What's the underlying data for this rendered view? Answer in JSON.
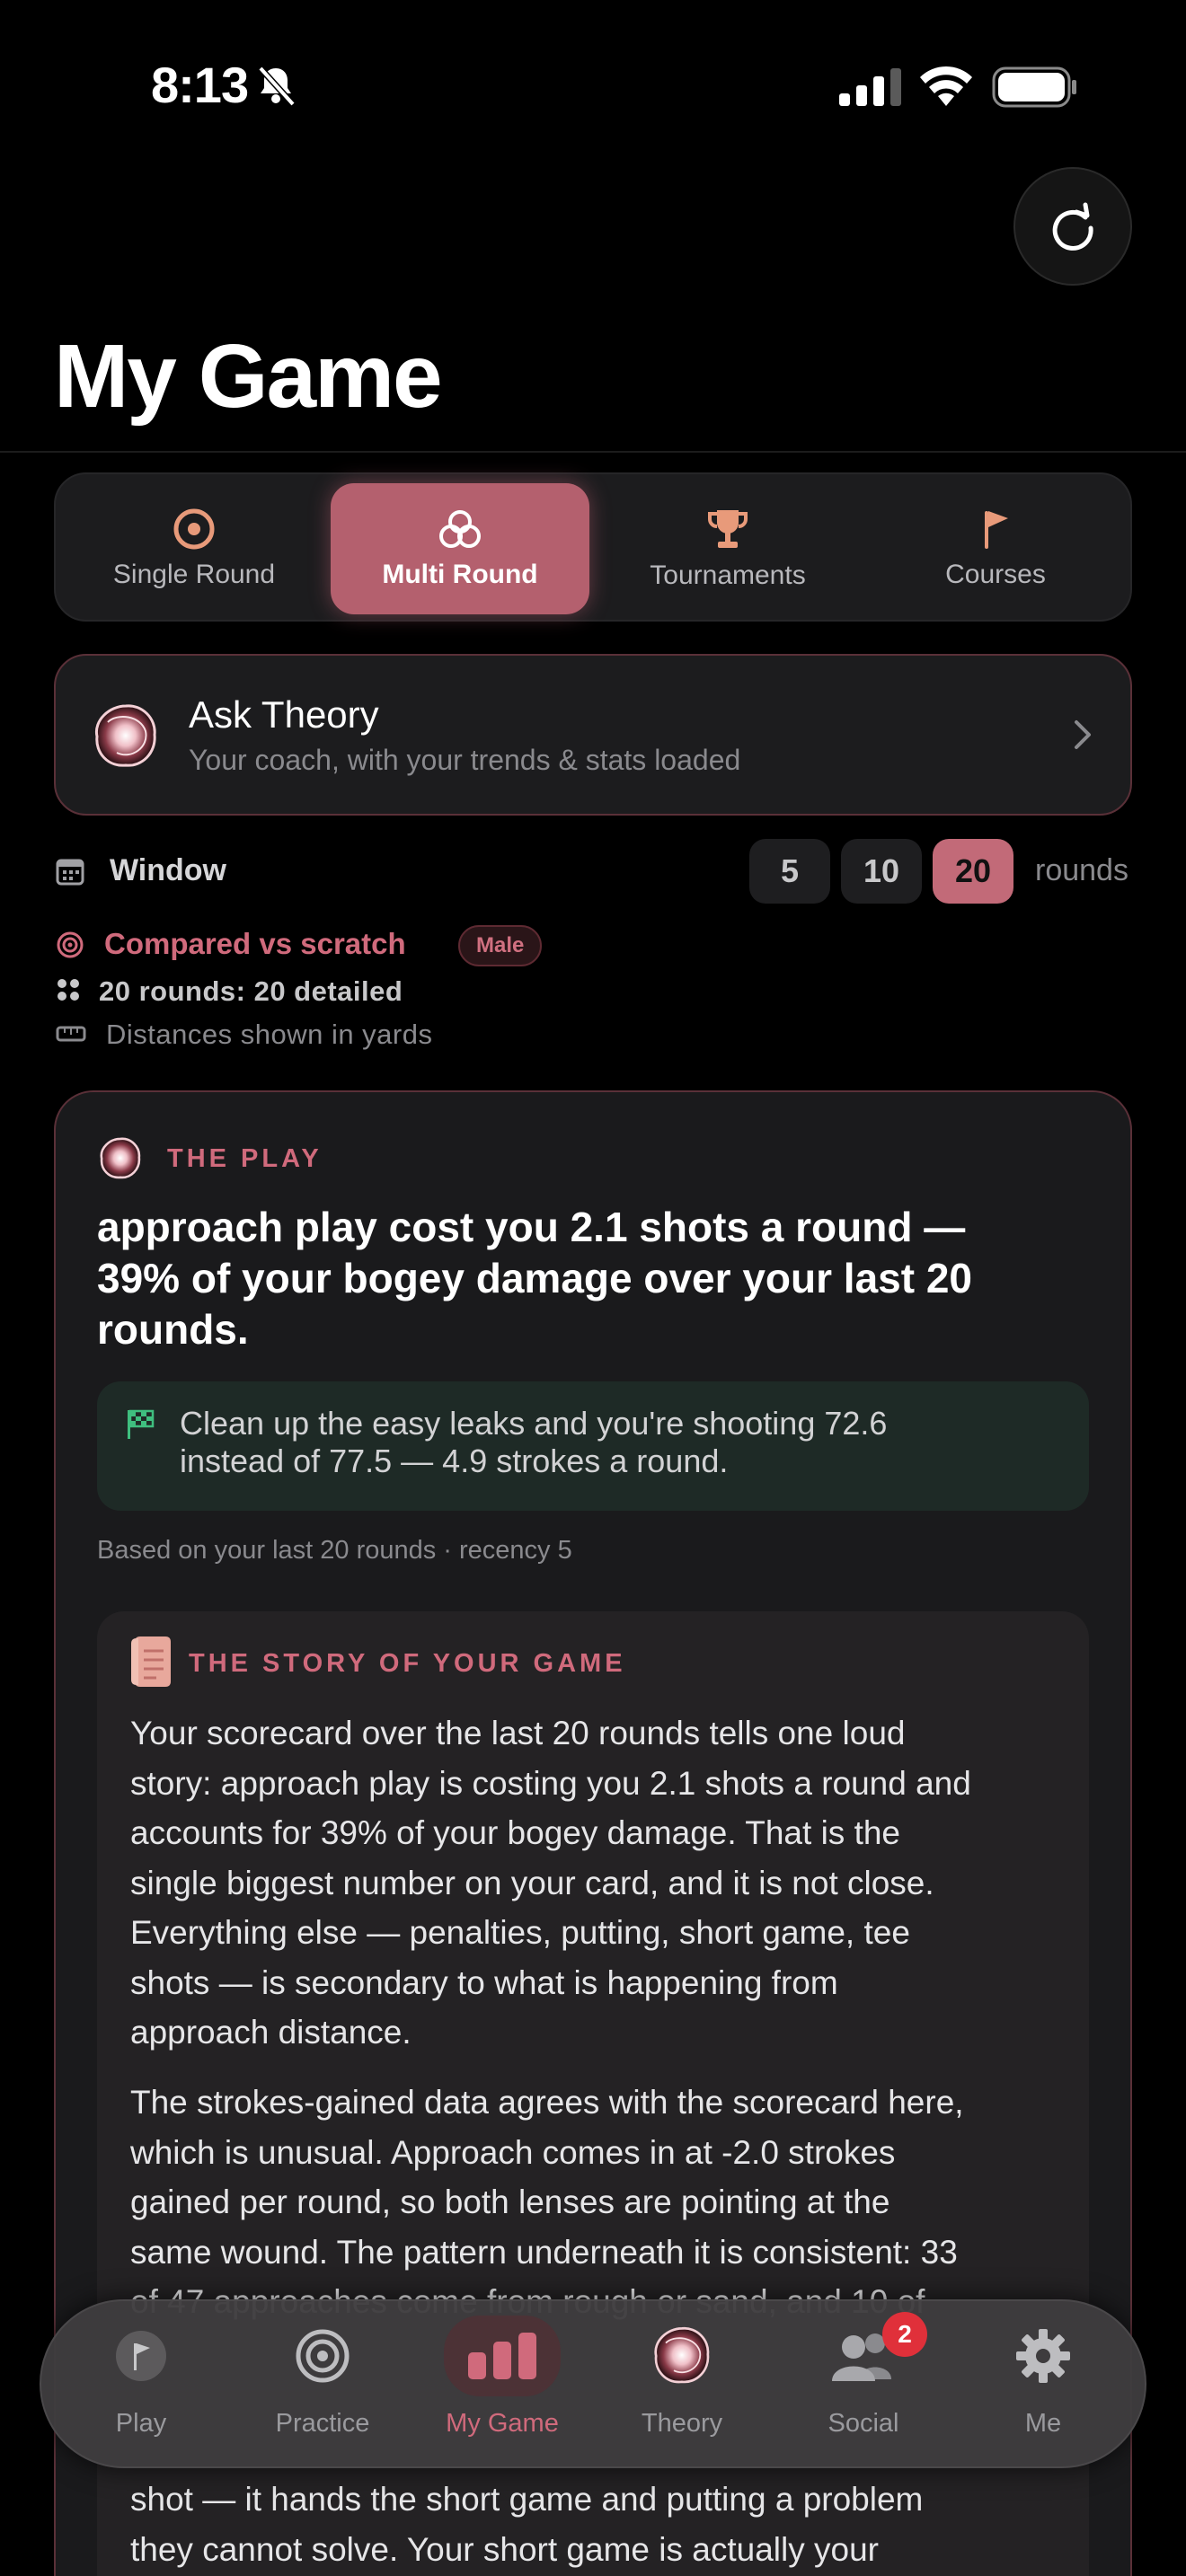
{
  "status_bar": {
    "time": "8:13"
  },
  "page": {
    "title": "My Game"
  },
  "segments": [
    {
      "label": "Single Round",
      "icon": "target-icon",
      "active": false
    },
    {
      "label": "Multi Round",
      "icon": "rings-icon",
      "active": true
    },
    {
      "label": "Tournaments",
      "icon": "trophy-icon",
      "active": false
    },
    {
      "label": "Courses",
      "icon": "flag-icon",
      "active": false
    }
  ],
  "ask_theory": {
    "title": "Ask Theory",
    "subtitle": "Your coach, with your trends & stats loaded"
  },
  "window": {
    "label": "Window",
    "options": [
      "5",
      "10",
      "20"
    ],
    "selected": "20",
    "unit": "rounds"
  },
  "comparison": {
    "text": "Compared vs scratch",
    "badge": "Male",
    "rounds_info": "20 rounds: 20 detailed",
    "distances": "Distances shown in yards"
  },
  "play_card": {
    "header": "THE PLAY",
    "headline_lines": [
      "approach play cost you 2.1 shots a round —",
      "39% of your bogey damage over your last 20",
      "rounds."
    ],
    "callout_lines": [
      "Clean up the easy leaks and you're shooting 72.6",
      "instead of 77.5 — 4.9 strokes a round."
    ],
    "based_on": "Based on your last 20 rounds · recency 5"
  },
  "story": {
    "header": "THE STORY OF YOUR GAME",
    "paragraph1_lines": [
      "Your scorecard over the last 20 rounds tells one loud",
      "story: approach play is costing you 2.1 shots a round and",
      "accounts for 39% of your bogey damage. That is the",
      "single biggest number on your card, and it is not close.",
      "Everything else — penalties, putting, short game, tee",
      "shots — is secondary to what is happening from",
      "approach distance."
    ],
    "paragraph2_lines": [
      "The strokes-gained data agrees with the scorecard here,",
      "which is unusual. Approach comes in at -2.0 strokes",
      "gained per round, so both lenses are pointing at the",
      "same wound. The pattern underneath it is consistent: 33",
      "of 47 approaches come from rough or sand, and 10 of"
    ],
    "paragraph3_lines": [
      "shot — it hands the short game and putting a problem",
      "they cannot solve. Your short game is actually your"
    ]
  },
  "tabbar": {
    "items": [
      {
        "label": "Play",
        "icon": "flag-icon"
      },
      {
        "label": "Practice",
        "icon": "target-icon"
      },
      {
        "label": "My Game",
        "icon": "bar-chart-icon",
        "active": true
      },
      {
        "label": "Theory",
        "icon": "theory-orb-icon"
      },
      {
        "label": "Social",
        "icon": "people-icon",
        "badge": "2"
      },
      {
        "label": "Me",
        "icon": "gear-icon"
      }
    ]
  },
  "colors": {
    "accent": "#d06a7c",
    "active_segment": "#b4606e",
    "background": "#000000",
    "card": "#1a1a1c",
    "callout_bg": "#1e2a26",
    "callout_icon": "#3fbf7f"
  }
}
